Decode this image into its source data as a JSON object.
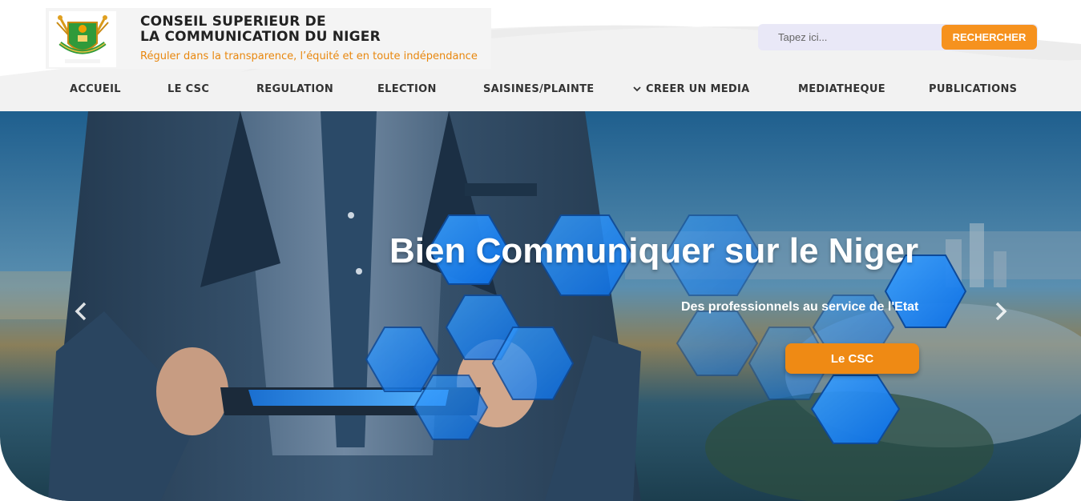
{
  "header": {
    "title_line1": "CONSEIL SUPERIEUR DE",
    "title_line2": "LA COMMUNICATION DU NIGER",
    "tagline": "Réguler dans la transparence, l’équité et en toute indépendance",
    "logo_icon": "niger-coat-of-arms-icon"
  },
  "search": {
    "placeholder": "Tapez ici...",
    "value": "",
    "button_label": "RECHERCHER"
  },
  "nav": {
    "items": [
      {
        "label": "ACCUEIL"
      },
      {
        "label": "LE CSC"
      },
      {
        "label": "REGULATION"
      },
      {
        "label": "ELECTION"
      },
      {
        "label": "SAISINES/PLAINTE"
      },
      {
        "label": "CREER UN MEDIA",
        "icon": "chevron-down-icon"
      },
      {
        "label": "MEDIATHEQUE"
      },
      {
        "label": "PUBLICATIONS"
      }
    ]
  },
  "hero": {
    "title": "Bien Communiquer sur le Niger",
    "subtitle": "Des professionnels au service de l'Etat",
    "button_label": "Le CSC",
    "prev_icon": "chevron-left-icon",
    "next_icon": "chevron-right-icon"
  },
  "colors": {
    "accent": "#f6921e",
    "tagline": "#e8870e",
    "search_bg": "#e9e8f7",
    "hex_blue": "#1e8fff"
  }
}
